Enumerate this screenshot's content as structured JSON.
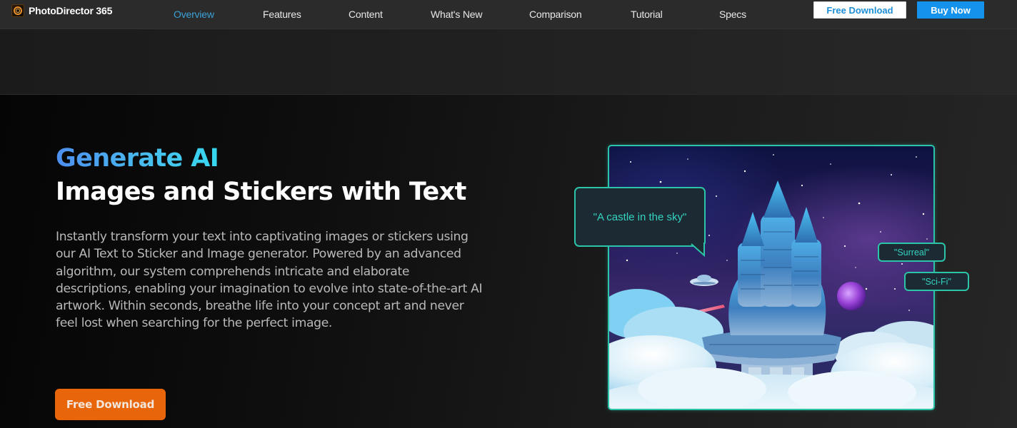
{
  "nav": {
    "brand": "PhotoDirector 365",
    "brand_icon": "photodirector-logo-icon",
    "links": [
      {
        "label": "Overview",
        "active": true
      },
      {
        "label": "Features",
        "active": false
      },
      {
        "label": "Content",
        "active": false
      },
      {
        "label": "What's New",
        "active": false
      },
      {
        "label": "Comparison",
        "active": false
      },
      {
        "label": "Tutorial",
        "active": false
      },
      {
        "label": "Specs",
        "active": false
      }
    ],
    "free_download_label": "Free Download",
    "buy_now_label": "Buy Now"
  },
  "hero": {
    "title_accent": "Generate AI",
    "title_main": "Images and Stickers with Text",
    "description": "Instantly transform your text into captivating images or stickers using our AI Text to Sticker and Image generator. Powered by an advanced algorithm, our system comprehends intricate and elaborate descriptions, enabling your imagination to evolve into state-of-the-art AI artwork. Within seconds, breathe life into your concept art and never feel lost when searching for the perfect image.",
    "cta_label": "Free Download"
  },
  "illustration": {
    "subject": "castle in the sky",
    "prompt_bubble": "\"A castle in the sky\"",
    "tags": [
      "\"Surreal\"",
      "\"Sci-Fi\""
    ]
  },
  "colors": {
    "nav_active": "#3aa1d8",
    "buy_button": "#1593ec",
    "cta_orange": "#e8650a",
    "bubble_accent": "#2cc4a8",
    "bubble_text": "#34d3c0"
  }
}
